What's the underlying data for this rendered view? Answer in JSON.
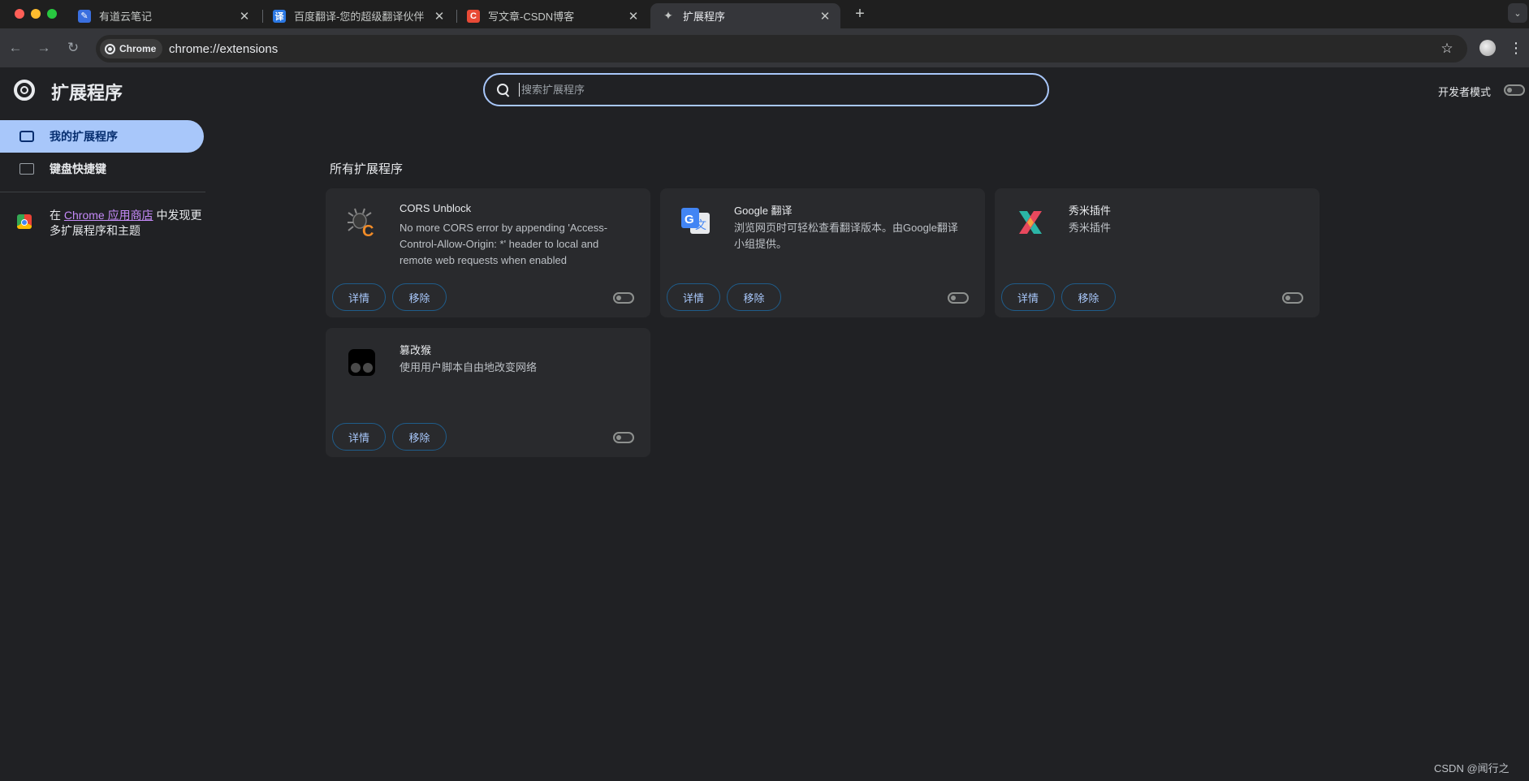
{
  "tabs": [
    {
      "title": "有道云笔记",
      "favicon": "youdao-note-icon",
      "color": "#3a6fdf",
      "glyph": "✎"
    },
    {
      "title": "百度翻译-您的超级翻译伙伴",
      "favicon": "baidu-translate-icon",
      "color": "#2b78e4",
      "glyph": "译"
    },
    {
      "title": "写文章-CSDN博客",
      "favicon": "csdn-icon",
      "color": "#e84a36",
      "glyph": "C"
    },
    {
      "title": "扩展程序",
      "favicon": "puzzle-icon",
      "color": "#35363a",
      "glyph": "✦"
    }
  ],
  "active_tab_index": 3,
  "toolbar": {
    "chip_label": "Chrome",
    "url": "chrome://extensions"
  },
  "header": {
    "title": "扩展程序",
    "search_placeholder": "搜索扩展程序",
    "dev_mode_label": "开发者模式"
  },
  "sidebar": {
    "items": [
      {
        "label": "我的扩展程序",
        "icon": "puzzle-icon",
        "active": true
      },
      {
        "label": "键盘快捷键",
        "icon": "keyboard-icon",
        "active": false
      }
    ],
    "store_prefix": "在 ",
    "store_link": "Chrome 应用商店",
    "store_suffix": " 中发现更多扩展程序和主题"
  },
  "section_title": "所有扩展程序",
  "extensions": [
    {
      "name": "CORS Unblock",
      "description": "No more CORS error by appending 'Access-Control-Allow-Origin: *' header to local and remote web requests when enabled",
      "icon": "cors-bug-icon",
      "enabled": false
    },
    {
      "name": "Google 翻译",
      "description": "浏览网页时可轻松查看翻译版本。由Google翻译小组提供。",
      "icon": "google-translate-icon",
      "enabled": false
    },
    {
      "name": "秀米插件",
      "description": "秀米插件",
      "icon": "xiumi-icon",
      "enabled": false
    },
    {
      "name": "篡改猴",
      "description": "使用用户脚本自由地改变网络",
      "icon": "tampermonkey-icon",
      "enabled": false
    }
  ],
  "buttons": {
    "details": "详情",
    "remove": "移除"
  },
  "watermark": "CSDN @闻行之",
  "colors": {
    "accent": "#a8c7fa",
    "background": "#202124",
    "card": "#292a2d",
    "link": "#c58af9"
  }
}
